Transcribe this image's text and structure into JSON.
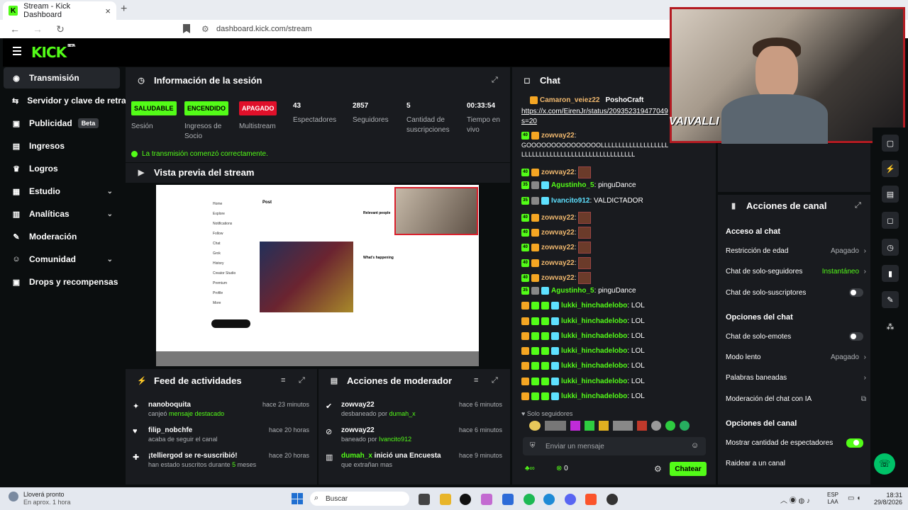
{
  "browser": {
    "tab_title": "Stream - Kick Dashboard",
    "new_tab": "+",
    "url": "dashboard.kick.com/stream"
  },
  "brand": {
    "logo": "KICK",
    "beta": "BETA",
    "accent": "#53fc18"
  },
  "sidebar": {
    "items": [
      {
        "label": "Transmisión",
        "icon": "broadcast-icon"
      },
      {
        "label": "Servidor y clave de retrans"
      },
      {
        "label": "Publicidad",
        "badge": "Beta"
      },
      {
        "label": "Ingresos"
      },
      {
        "label": "Logros"
      },
      {
        "label": "Estudio"
      },
      {
        "label": "Analíticas"
      },
      {
        "label": "Moderación"
      },
      {
        "label": "Comunidad"
      },
      {
        "label": "Drops y recompensas"
      }
    ]
  },
  "session": {
    "title": "Información de la sesión",
    "stats": [
      {
        "pill": "SALUDABLE",
        "label": "Sesión"
      },
      {
        "pill": "ENCENDIDO",
        "label1": "Ingresos de",
        "label2": "Socio"
      },
      {
        "pill": "APAGADO",
        "label": "Multistream"
      },
      {
        "value": "43",
        "label": "Espectadores"
      },
      {
        "value": "2857",
        "label": "Seguidores"
      },
      {
        "value": "5",
        "label1": "Cantidad de",
        "label2": "suscripciones"
      },
      {
        "value": "00:33:54",
        "label1": "Tiempo en",
        "label2": "vivo"
      }
    ],
    "ok": "La transmisión comenzó correctamente."
  },
  "preview": {
    "title": "Vista previa del stream",
    "tweet": {
      "side": [
        "Home",
        "Explore",
        "Notifications",
        "Follow",
        "Chat",
        "Grok",
        "History",
        "Creator Studio",
        "Premium",
        "Profile",
        "More"
      ],
      "post": "Post",
      "relevant": "Relevant people",
      "happening": "What's happening"
    }
  },
  "feed": {
    "title": "Feed de actividades",
    "items": [
      {
        "user": "nanoboquita",
        "pre": "canjeó ",
        "hl": "mensaje destacado",
        "time": "hace 23 minutos"
      },
      {
        "user": "filip_nobchfe",
        "pre": "acaba de seguir el canal",
        "hl": "",
        "time": "hace 20 horas"
      },
      {
        "user": "¡telliergod se re-suscribió!",
        "pre": "han estado suscritos durante ",
        "hl": "5",
        "post": " meses",
        "time": "hace 20 horas"
      }
    ]
  },
  "mod": {
    "title": "Acciones de moderador",
    "items": [
      {
        "user": "zowvay22",
        "pre": "desbaneado por ",
        "hl": "dumah_x",
        "time": "hace 6 minutos"
      },
      {
        "user": "zowvay22",
        "pre": "baneado por ",
        "hl": "Ivancito912",
        "time": "hace 6 minutos"
      },
      {
        "user": "dumah_x",
        "user_rest": " inició una Encuesta",
        "pre": "que extrañan mas",
        "hl": "",
        "time": "hace 9 minutos"
      }
    ]
  },
  "chat": {
    "title": "Chat",
    "top": {
      "u1": "Camaron_veiez22",
      "u2": "PoshoCraft",
      "link1": "https://x.com/EirenJr/status/209352319477049",
      "link2": "s=20"
    },
    "z1": {
      "user": "zowvay22",
      "text1": "GOOOOOOOOOOOOOOOLLLLLLLLLLLLLLLLLLL",
      "text2": "LLLLLLLLLLLLLLLLLLLLLLLLLLLLLLLL"
    },
    "rows": [
      {
        "user": "zowvay22",
        "text": ""
      },
      {
        "user": "Agustinho_5",
        "text": "pinguDance"
      },
      {
        "user": "Ivancito912",
        "text": "VALDICTADOR"
      },
      {
        "user": "zowvay22",
        "text": ""
      },
      {
        "user": "zowvay22",
        "text": ""
      },
      {
        "user": "zowvay22",
        "text": ""
      },
      {
        "user": "zowvay22",
        "text": ""
      },
      {
        "user": "zowvay22",
        "text": ""
      },
      {
        "user": "Agustinho_5",
        "text": "pinguDance"
      },
      {
        "user": "lukki_hinchadelobo",
        "text": "LOL"
      },
      {
        "user": "lukki_hinchadelobo",
        "text": "LOL"
      },
      {
        "user": "lukki_hinchadelobo",
        "text": "LOL"
      },
      {
        "user": "lukki_hinchadelobo",
        "text": "LOL"
      },
      {
        "user": "lukki_hinchadelobo",
        "text": "LOL"
      },
      {
        "user": "lukki_hinchadelobo",
        "text": "LOL"
      },
      {
        "user": "lukki_hinchadelobo",
        "text": "LOL"
      }
    ],
    "followers_only": "Solo seguidores",
    "input_placeholder": "Enviar un mensaje",
    "points": "0",
    "send": "Chatear"
  },
  "canal": {
    "title": "Acciones de canal",
    "acceso": "Acceso al chat",
    "age": {
      "label": "Restricción de edad",
      "value": "Apagado"
    },
    "followers": {
      "label": "Chat de solo-seguidores",
      "value": "Instantáneo"
    },
    "subs": {
      "label": "Chat de solo-suscriptores"
    },
    "opciones_chat": "Opciones del chat",
    "emotes": {
      "label": "Chat de solo-emotes"
    },
    "slow": {
      "label": "Modo lento",
      "value": "Apagado"
    },
    "banned": {
      "label": "Palabras baneadas"
    },
    "ai": {
      "label": "Moderación del chat con IA"
    },
    "opciones_canal": "Opciones del canal",
    "viewers": {
      "label": "Mostrar cantidad de espectadores"
    },
    "raid": {
      "label": "Raidear a un canal"
    }
  },
  "webcam": {
    "overlay": "VAIVALLI"
  },
  "taskbar": {
    "weather1": "Lloverá pronto",
    "weather2": "En aprox. 1 hora",
    "search": "Buscar",
    "lang1": "ESP",
    "lang2": "LAA",
    "time": "18:31",
    "date": "29/8/2026"
  }
}
